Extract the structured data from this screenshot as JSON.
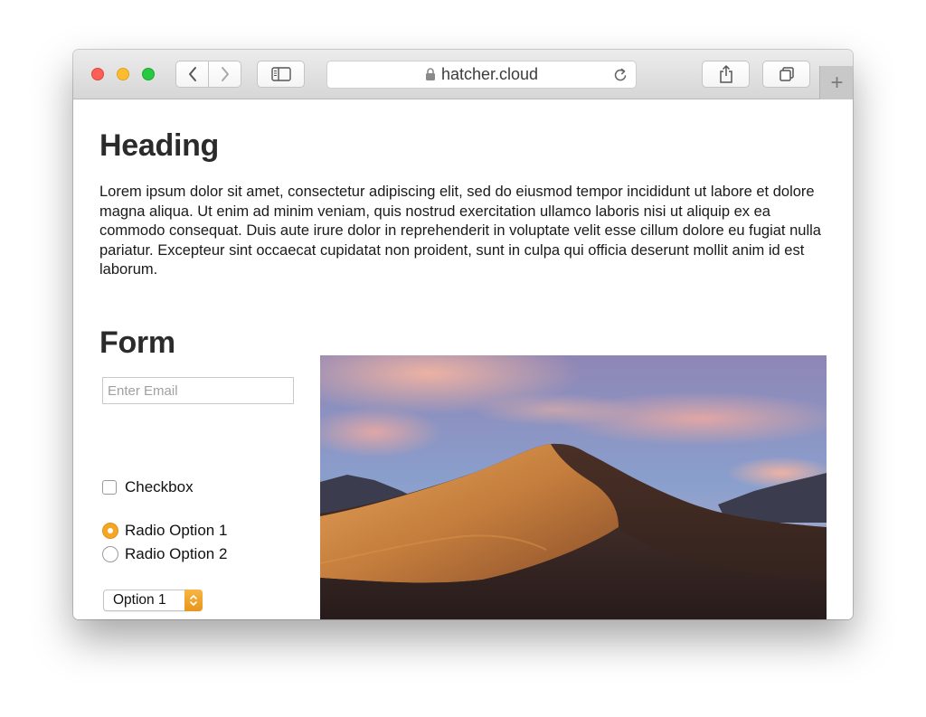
{
  "browser": {
    "address": "hatcher.cloud",
    "new_tab_label": "+"
  },
  "page": {
    "heading": "Heading",
    "paragraph": "Lorem ipsum dolor sit amet, consectetur adipiscing elit, sed do eiusmod tempor incididunt ut labore et dolore magna aliqua. Ut enim ad minim veniam, quis nostrud exercitation ullamco laboris nisi ut aliquip ex ea commodo consequat. Duis aute irure dolor in reprehenderit in voluptate velit esse cillum dolore eu fugiat nulla pariatur. Excepteur sint occaecat cupidatat non proident, sunt in culpa qui officia deserunt mollit anim id est laborum."
  },
  "form": {
    "title": "Form",
    "email_placeholder": "Enter Email",
    "checkbox_label": "Checkbox",
    "radio1_label": "Radio Option 1",
    "radio2_label": "Radio Option 2",
    "select_value": "Option 1"
  },
  "colors": {
    "accent": "#f5a623",
    "traffic_red": "#fe5f57",
    "traffic_yellow": "#febc2e",
    "traffic_green": "#28c840"
  },
  "icons": {
    "lock": "lock-icon",
    "reload": "reload-icon",
    "share": "share-icon",
    "tabs": "tabs-overview-icon",
    "sidebar": "sidebar-icon",
    "back": "chevron-left-icon",
    "forward": "chevron-right-icon"
  }
}
